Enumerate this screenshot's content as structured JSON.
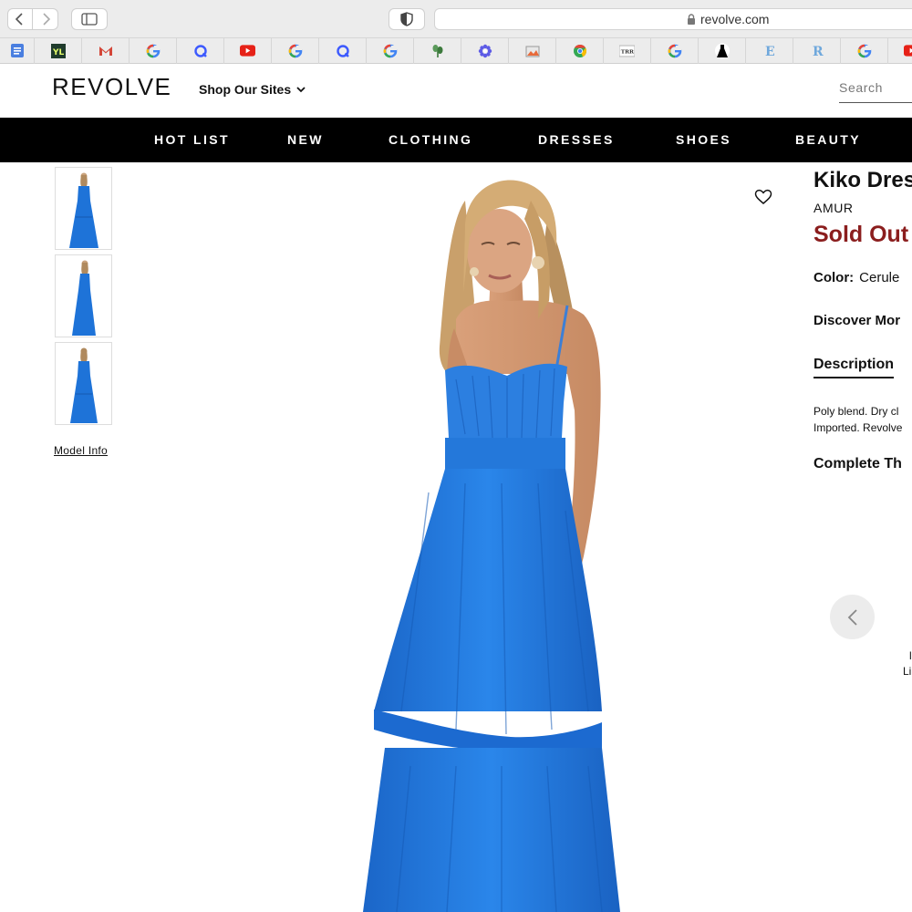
{
  "browser": {
    "url": "revolve.com",
    "bookmarks": [
      {
        "icon": "docs-icon",
        "color": "#4a7fe0"
      },
      {
        "icon": "yl-icon",
        "color": "#1f3b2c"
      },
      {
        "icon": "gmail-icon",
        "color": "#d44638"
      },
      {
        "icon": "google-icon",
        "color": "#4285f4"
      },
      {
        "icon": "q-icon",
        "color": "#3d5afe"
      },
      {
        "icon": "youtube-icon",
        "color": "#e62117"
      },
      {
        "icon": "google-icon",
        "color": "#4285f4"
      },
      {
        "icon": "q-icon",
        "color": "#3d5afe"
      },
      {
        "icon": "google-icon",
        "color": "#4285f4"
      },
      {
        "icon": "plant-icon",
        "color": "#3c7a3c"
      },
      {
        "icon": "flower-icon",
        "color": "#5e5ce6"
      },
      {
        "icon": "image-icon",
        "color": "#888888"
      },
      {
        "icon": "chrome-icon",
        "color": "#34a853"
      },
      {
        "icon": "trr-icon",
        "color": "#333333"
      },
      {
        "icon": "google-icon",
        "color": "#4285f4"
      },
      {
        "icon": "dress-icon",
        "color": "#000000"
      },
      {
        "icon": "e-icon",
        "color": "#6fa8dc"
      },
      {
        "icon": "r-icon",
        "color": "#6fa8dc"
      },
      {
        "icon": "google-icon",
        "color": "#4285f4"
      },
      {
        "icon": "youtube-icon",
        "color": "#e62117"
      }
    ]
  },
  "header": {
    "logo": "REVOLVE",
    "shop_sites": "Shop Our Sites",
    "search_placeholder": "Search"
  },
  "nav": {
    "items": [
      "HOT LIST",
      "NEW",
      "CLOTHING",
      "DRESSES",
      "SHOES",
      "BEAUTY"
    ]
  },
  "gallery": {
    "model_info": "Model Info",
    "dress_color": "#1e73d8"
  },
  "product": {
    "name": "Kiko Dres",
    "brand": "AMUR",
    "status": "Sold Out",
    "color_label": "Color:",
    "color_value": "Cerule",
    "discover": "Discover Mor",
    "description_tab": "Description",
    "description_line1": "Poly blend. Dry cl",
    "description_line2": "Imported. Revolve",
    "complete": "Complete Th",
    "cut_text_1": "l",
    "cut_text_2": "Li"
  },
  "colors": {
    "sold_out": "#8b1e1e",
    "nav_bg": "#000000"
  }
}
